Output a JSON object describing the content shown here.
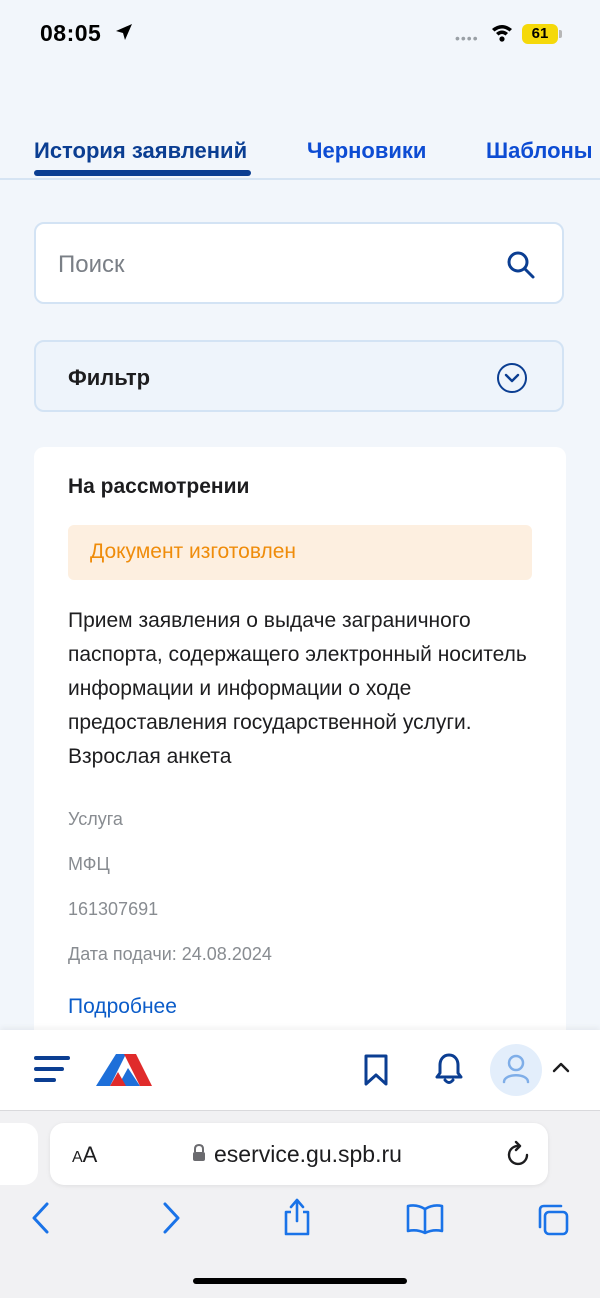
{
  "status_bar": {
    "time": "08:05",
    "battery": "61"
  },
  "tabs": [
    {
      "label": "История заявлений",
      "active": true
    },
    {
      "label": "Черновики",
      "active": false
    },
    {
      "label": "Шаблоны",
      "active": false
    }
  ],
  "search": {
    "placeholder": "Поиск"
  },
  "filter": {
    "label": "Фильтр"
  },
  "card": {
    "status": "На рассмотрении",
    "badge": "Документ изготовлен",
    "description": "Прием заявления о выдаче заграничного паспорта, содержащего электронный носитель информации и информации о ходе предоставления государственной услуги. Взрослая анкета",
    "meta": [
      "Услуга",
      "МФЦ",
      "161307691",
      "Дата подачи: 24.08.2024"
    ],
    "more_link": "Подробнее"
  },
  "browser": {
    "aa_small": "A",
    "aa_large": "A",
    "url": "eservice.gu.spb.ru"
  },
  "colors": {
    "primary": "#0b3e92",
    "link": "#0b5cc9",
    "badge_text": "#ef8c0b",
    "badge_bg": "#fdefe0"
  }
}
